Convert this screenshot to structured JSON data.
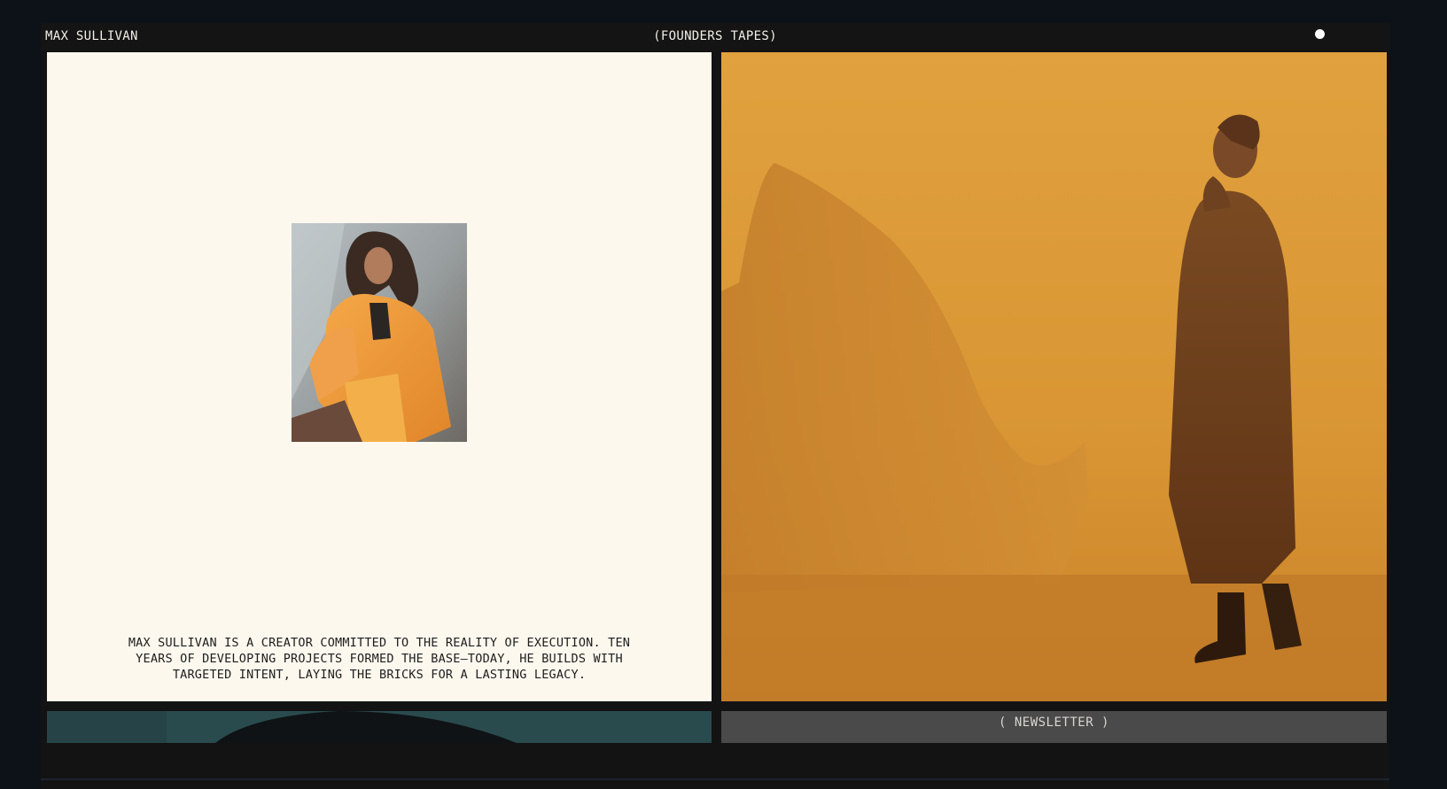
{
  "header": {
    "brand": "MAX SULLIVAN",
    "title": "(FOUNDERS TAPES)"
  },
  "bio": {
    "text": "MAX SULLIVAN IS A CREATOR COMMITTED TO THE REALITY OF EXECUTION. TEN YEARS OF DEVELOPING PROJECTS FORMED THE BASE—TODAY, HE BUILDS WITH TARGETED INTENT, LAYING THE BRICKS FOR A LASTING LEGACY."
  },
  "newsletter": {
    "label": "( NEWSLETTER )"
  },
  "colors": {
    "page_bg": "#0d1118",
    "left_panel_bg": "#fdf8ee",
    "accent_orange": "#e2a33c",
    "newsletter_bg": "#4a4a4a"
  },
  "icons": {
    "status_dot": "status-dot-icon"
  }
}
